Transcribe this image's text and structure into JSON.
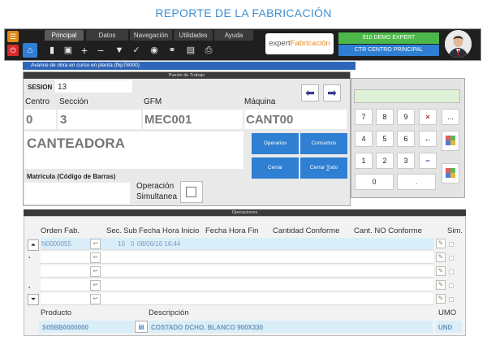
{
  "page_title": "REPORTE DE LA FABRICACIÓN",
  "menu": {
    "tabs": [
      "Principal",
      "Datos",
      "Navegación",
      "Utilidades",
      "Ayuda"
    ],
    "active_tab": "Principal"
  },
  "toolbar": {
    "icons": [
      "new-document-icon",
      "save-icon",
      "add-icon",
      "remove-icon",
      "filter-icon",
      "check-icon",
      "record-icon",
      "link-icon",
      "options-icon",
      "print-icon"
    ]
  },
  "brand": {
    "logo_prefix": "expert",
    "logo_suffix": "Fabricación"
  },
  "user_box": {
    "line1": "910 DEMO EXPERT",
    "line2": "CTR CENTRO PRINCIPAL"
  },
  "window": {
    "title": "Avance de obra en curso en planta (fbp78000)"
  },
  "workstation": {
    "header": "Puesto de Trabajo",
    "session_label": "SESION",
    "session_value": "13",
    "centro_label": "Centro",
    "centro_value": "0",
    "seccion_label": "Sección",
    "seccion_value": "3",
    "gfm_label": "GFM",
    "gfm_value": "MEC001",
    "maquina_label": "Máquina",
    "maquina_value": "CANT00",
    "machine_name": "CANTEADORA",
    "matricula_label": "Matrícula (Código de Barras)",
    "matricula_value": "",
    "op_simultanea_label_1": "Operación",
    "op_simultanea_label_2": "Simultanea",
    "op_simultanea_checked": false
  },
  "actions": {
    "operarios": "Operarios",
    "consumos": "Consumos",
    "cerrar": "Cerrar",
    "cerrar_todo_pre": "Cerrar ",
    "cerrar_todo_u": "T",
    "cerrar_todo_post": "odo"
  },
  "keypad": {
    "rows": [
      [
        "7",
        "8",
        "9",
        "×",
        "..."
      ],
      [
        "4",
        "5",
        "6",
        "←"
      ],
      [
        "1",
        "2",
        "3",
        "−"
      ],
      [
        "0",
        "."
      ]
    ]
  },
  "operations": {
    "header": "Operaciones",
    "columns": [
      "Orden Fab.",
      "Sec.",
      "Sub",
      "Fecha Hora Inicio",
      "Fecha Hora Fin",
      "Cantidad Conforme",
      "Cant. NO Conforme",
      "Sim."
    ],
    "rows": [
      {
        "orden": "N0000055",
        "sec": "10",
        "sub": "0",
        "inicio": "08/06/16 16:44",
        "fin": "",
        "conforme": "",
        "no_conforme": ""
      },
      {
        "orden": "",
        "sec": "",
        "sub": "",
        "inicio": "",
        "fin": "",
        "conforme": "",
        "no_conforme": ""
      },
      {
        "orden": "",
        "sec": "",
        "sub": "",
        "inicio": "",
        "fin": "",
        "conforme": "",
        "no_conforme": ""
      },
      {
        "orden": "",
        "sec": "",
        "sub": "",
        "inicio": "",
        "fin": "",
        "conforme": "",
        "no_conforme": ""
      },
      {
        "orden": "",
        "sec": "",
        "sub": "",
        "inicio": "",
        "fin": "",
        "conforme": "",
        "no_conforme": ""
      }
    ],
    "product_label": "Producto",
    "product_value": "S05BB0000000",
    "description_label": "Descripción",
    "description_value": "COSTADO DCHO. BLANCO 900X330",
    "umo_label": "UMO",
    "umo_value": "UND"
  },
  "colors": {
    "accent_blue": "#2f7fd3",
    "header_dark": "#3a3a3a",
    "demo_green": "#4cb84a",
    "title_blue": "#3d8fd3"
  }
}
